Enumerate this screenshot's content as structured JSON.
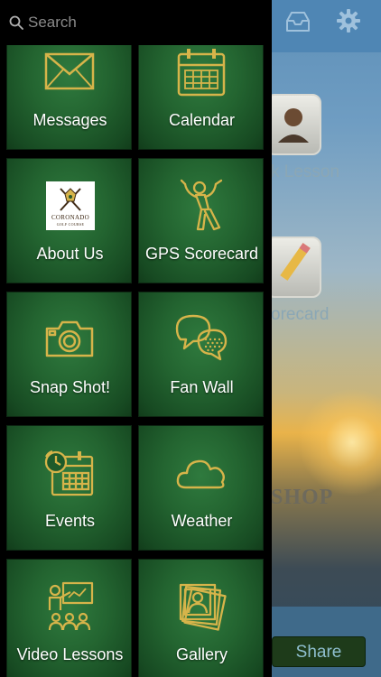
{
  "search": {
    "placeholder": "Search"
  },
  "menu_items": [
    {
      "label": "Messages",
      "icon": "envelope-icon"
    },
    {
      "label": "Calendar",
      "icon": "calendar-icon"
    },
    {
      "label": "About Us",
      "icon": "coronado-logo"
    },
    {
      "label": "GPS Scorecard",
      "icon": "golfer-icon"
    },
    {
      "label": "Snap Shot!",
      "icon": "camera-icon"
    },
    {
      "label": "Fan Wall",
      "icon": "speech-bubbles-icon"
    },
    {
      "label": "Events",
      "icon": "calendar-clock-icon"
    },
    {
      "label": "Weather",
      "icon": "cloud-icon"
    },
    {
      "label": "Video Lessons",
      "icon": "classroom-icon"
    },
    {
      "label": "Gallery",
      "icon": "photo-stack-icon"
    }
  ],
  "logo": {
    "name": "CORONADO",
    "sub": "GOLF COURSE"
  },
  "background": {
    "label_1": "k Lesson",
    "label_2": "orecard",
    "shop_text": "SHOP",
    "share_label": "Share"
  },
  "colors": {
    "tile_green": "#236430",
    "icon_gold": "#d6b44a",
    "drawer_bg": "#000000"
  }
}
